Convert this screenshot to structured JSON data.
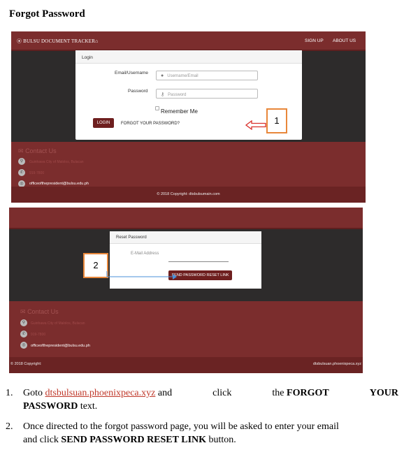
{
  "title": "Forgot Password",
  "shot1": {
    "brand": "BULSU DOCUMENT TRACKER",
    "nav": [
      "SIGN UP",
      "ABOUT US"
    ],
    "card_title": "Login",
    "email_label": "Email/Username",
    "email_placeholder": "Username/Email",
    "password_label": "Password",
    "password_placeholder": "Password",
    "remember": "Remember Me",
    "login_button": "LOGIN",
    "forgot_link": "FORGOT YOUR PASSWORD?",
    "contact_heading": "Contact Us",
    "address": "Guinhawa City of Malolos, Bulacan",
    "phone": "919-7800",
    "email": "officeofthepresident@bulsu.edu.ph",
    "copyright": "© 2018 Copyright: dtsbulsumain.com",
    "callout": "1"
  },
  "shot2": {
    "card_title": "Reset Password",
    "email_label": "E-Mail Address",
    "reset_button": "SEND PASSWORD RESET LINK",
    "contact_heading": "Contact Us",
    "address": "Guinhawa City of Malolos, Bulacan",
    "phone": "919-7800",
    "email": "officeofthepresident@bulsu.edu.ph",
    "copyright_left": "© 2018 Copyright:",
    "copyright_right": "dtsbulsuan.phoenixpeca.xyz",
    "callout": "2"
  },
  "steps": {
    "step1": {
      "num": "1.",
      "goto": "Goto",
      "link": "dtsbulsuan.phoenixpeca.xyz",
      "and": "and",
      "click": "click",
      "the": "the",
      "forgot": "FORGOT",
      "your": "YOUR",
      "password": "PASSWORD",
      "text": "text."
    },
    "step2": {
      "num": "2.",
      "line1": "Once directed to the forgot password page, you will be asked to enter your email",
      "and_click": "and click",
      "button": "SEND PASSWORD RESET LINK",
      "tail": "button."
    }
  },
  "colors": {
    "maroon": "#7b2d2d",
    "button": "#6e1f1f",
    "callout": "#e8873a",
    "arrow_red": "#d9302b",
    "arrow_blue": "#4a90d9"
  }
}
